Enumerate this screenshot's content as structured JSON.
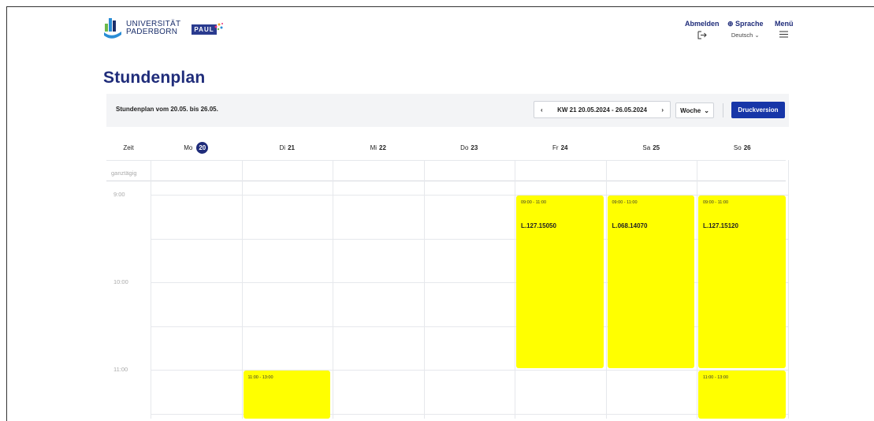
{
  "header": {
    "university_line1": "UNIVERSITÄT",
    "university_line2": "PADERBORN",
    "paul_logo": "PAUL",
    "logout": {
      "label": "Abmelden",
      "icon": "logout-icon"
    },
    "language": {
      "label": "⊕ Sprache",
      "value": "Deutsch ⌄"
    },
    "menu": {
      "label": "Menü",
      "icon": "hamburger-icon"
    }
  },
  "page": {
    "title": "Stundenplan"
  },
  "toolbar": {
    "range_label": "Stundenplan vom 20.05. bis 26.05.",
    "prev": "‹",
    "week": "KW 21 20.05.2024 - 26.05.2024",
    "next": "›",
    "view": "Woche",
    "view_caret": "⌄",
    "print": "Druckversion"
  },
  "calendar": {
    "time_column": "Zeit",
    "allday_label": "ganztägig",
    "days": [
      {
        "prefix": "Mo",
        "num": "20",
        "today": true
      },
      {
        "prefix": "Di",
        "num": "21",
        "today": false
      },
      {
        "prefix": "Mi",
        "num": "22",
        "today": false
      },
      {
        "prefix": "Do",
        "num": "23",
        "today": false
      },
      {
        "prefix": "Fr",
        "num": "24",
        "today": false
      },
      {
        "prefix": "Sa",
        "num": "25",
        "today": false
      },
      {
        "prefix": "So",
        "num": "26",
        "today": false
      }
    ],
    "times": [
      "9:00",
      "10:00",
      "11:00"
    ],
    "events": [
      {
        "day": 4,
        "time": "09:00 - 11:00",
        "title": "L.127.15050"
      },
      {
        "day": 5,
        "time": "09:00 - 11:00",
        "title": "L.068.14070"
      },
      {
        "day": 6,
        "time": "09:00 - 11:00",
        "title": "L.127.15120"
      },
      {
        "day": 1,
        "time": "11:00 - 13:00",
        "title": ""
      },
      {
        "day": 6,
        "time": "11:00 - 13:00",
        "title": ""
      }
    ],
    "event_color": "#ffff00",
    "scroll_up": "⌃",
    "scroll_down": "⌄"
  }
}
